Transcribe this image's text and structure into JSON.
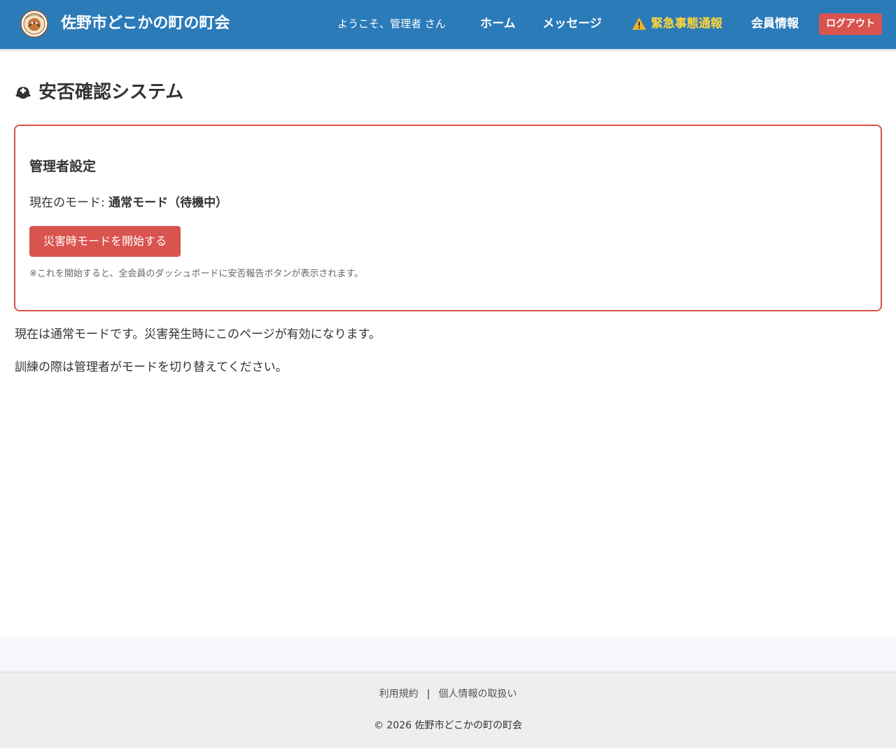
{
  "header": {
    "site_title": "佐野市どこかの町の町会",
    "logo_icon": "town-emblem-icon",
    "welcome": "ようこそ、管理者 さん",
    "nav": {
      "home": "ホーム",
      "messages": "メッセージ",
      "emergency": "緊急事態通報",
      "emergency_icon": "warning-icon",
      "members": "会員情報"
    },
    "logout": "ログアウト"
  },
  "colors": {
    "header_bg": "#2b7bb9",
    "danger": "#d9534f",
    "emergency_text": "#ffd43b"
  },
  "main": {
    "title_icon": "helmet-icon",
    "title": "安否確認システム",
    "admin": {
      "heading": "管理者設定",
      "mode_label": "現在のモード: ",
      "mode_value": "通常モード（待機中）",
      "start_button": "災害時モードを開始する",
      "note": "※これを開始すると、全会員のダッシュボードに安否報告ボタンが表示されます。"
    },
    "info_lines": [
      "現在は通常モードです。災害発生時にこのページが有効になります。",
      "訓練の際は管理者がモードを切り替えてください。"
    ]
  },
  "footer": {
    "terms": "利用規約",
    "separator": "|",
    "privacy": "個人情報の取扱い",
    "copyright": "© 2026 佐野市どこかの町の町会"
  }
}
